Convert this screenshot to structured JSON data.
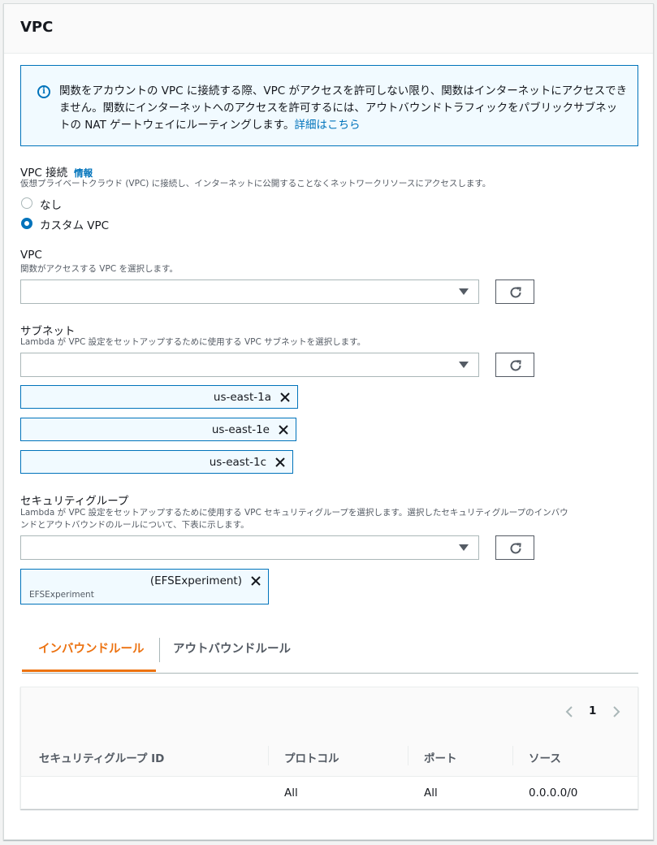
{
  "panel": {
    "title": "VPC"
  },
  "info": {
    "text": "関数をアカウントの VPC に接続する際、VPC がアクセスを許可しない限り、関数はインターネットにアクセスできません。関数にインターネットへのアクセスを許可するには、アウトバウンドトラフィックをパブリックサブネットの NAT ゲートウェイにルーティングします。",
    "link": "詳細はこちら",
    "icon": "info-icon"
  },
  "vpc_connection": {
    "label": "VPC 接続",
    "info_link": "情報",
    "description": "仮想プライベートクラウド (VPC) に接続し、インターネットに公開することなくネットワークリソースにアクセスします。",
    "options": [
      "なし",
      "カスタム VPC"
    ],
    "selected": "カスタム VPC"
  },
  "vpc": {
    "label": "VPC",
    "description": "関数がアクセスする VPC を選択します。",
    "value": ""
  },
  "subnet": {
    "label": "サブネット",
    "description": "Lambda が VPC 設定をセットアップするために使用する VPC サブネットを選択します。",
    "value": "",
    "tokens": [
      "us-east-1a",
      "us-east-1e",
      "us-east-1c"
    ]
  },
  "security_group": {
    "label": "セキュリティグループ",
    "description_line1": "Lambda が VPC 設定をセットアップするために使用する VPC セキュリティグループを選択します。選択したセキュリティグループのインバウ",
    "description_line2": "ンドとアウトバウンドのルールについて、下表に示します。",
    "value": "",
    "token": {
      "label": "(EFSExperiment)",
      "sub": "EFSExperiment"
    }
  },
  "tabs": [
    {
      "label": "インバウンドルール",
      "active": true
    },
    {
      "label": "アウトバウンドルール",
      "active": false
    }
  ],
  "table": {
    "page": "1",
    "columns": [
      "セキュリティグループ ID",
      "プロトコル",
      "ポート",
      "ソース"
    ],
    "rows": [
      {
        "id": "",
        "protocol": "All",
        "port": "All",
        "source": "0.0.0.0/0"
      }
    ]
  },
  "colors": {
    "accent": "#0073bb",
    "active_tab": "#ec7211",
    "info_bg": "#f1faff"
  }
}
